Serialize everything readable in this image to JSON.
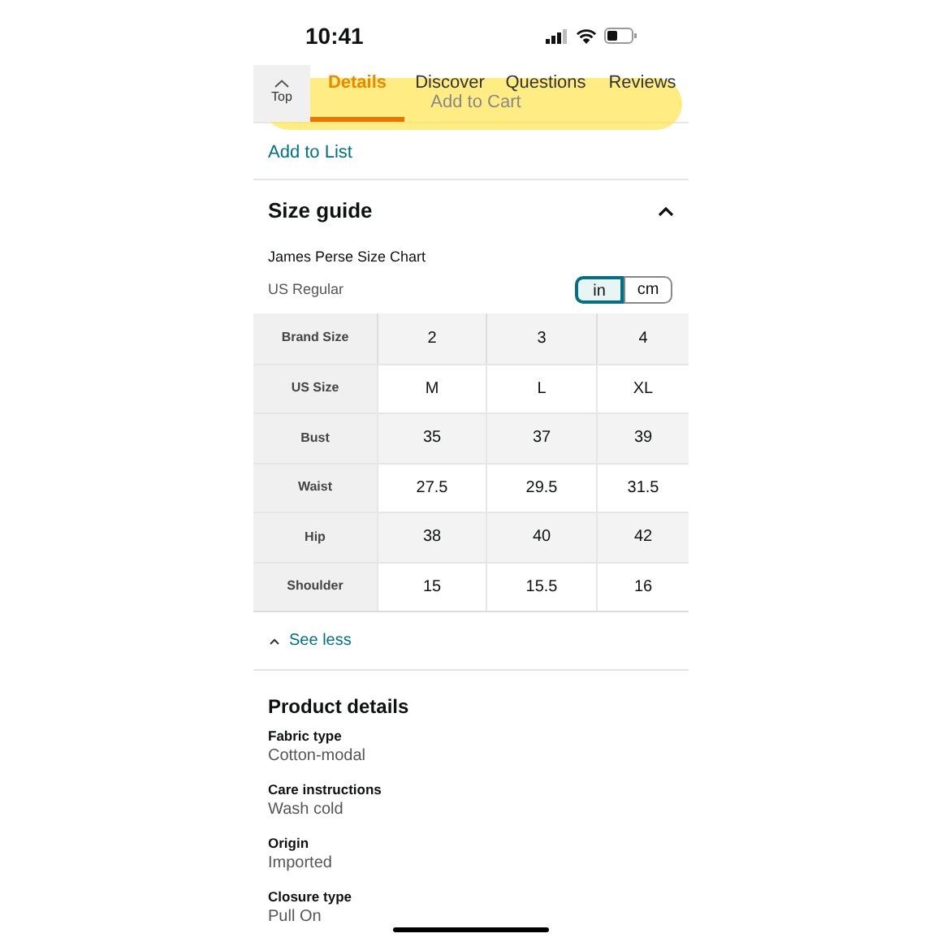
{
  "status_bar": {
    "time": "10:41"
  },
  "tabs": {
    "top_label": "Top",
    "items": [
      {
        "label": "Details",
        "selected": true
      },
      {
        "label": "Discover",
        "selected": false
      },
      {
        "label": "Questions",
        "selected": false
      },
      {
        "label": "Reviews",
        "selected": false
      }
    ]
  },
  "add_to_cart": {
    "label": "Add to Cart"
  },
  "add_to_list": "Add to List",
  "size_guide": {
    "title": "Size guide",
    "expanded": true,
    "chart_title": "James Perse Size Chart",
    "region": "US Regular",
    "units": [
      {
        "label": "in",
        "selected": true
      },
      {
        "label": "cm",
        "selected": false
      }
    ],
    "rows": [
      [
        "Brand Size",
        "2",
        "3",
        "4"
      ],
      [
        "US Size",
        "M",
        "L",
        "XL"
      ],
      [
        "Bust",
        "35",
        "37",
        "39"
      ],
      [
        "Waist",
        "27.5",
        "29.5",
        "31.5"
      ],
      [
        "Hip",
        "38",
        "40",
        "42"
      ],
      [
        "Shoulder",
        "15",
        "15.5",
        "16"
      ]
    ],
    "see_less": "See less"
  },
  "product_details": {
    "title": "Product details",
    "fields": [
      {
        "label": "Fabric type",
        "value": "Cotton-modal"
      },
      {
        "label": "Care instructions",
        "value": "Wash cold"
      },
      {
        "label": "Origin",
        "value": "Imported"
      },
      {
        "label": "Closure type",
        "value": "Pull On"
      }
    ]
  }
}
